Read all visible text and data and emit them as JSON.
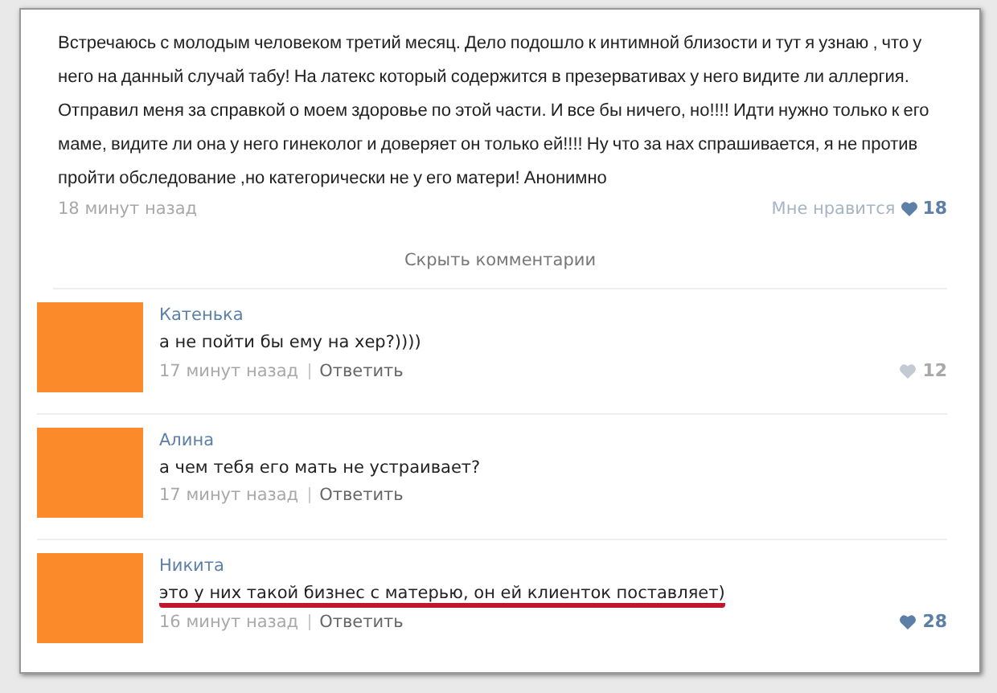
{
  "post": {
    "text": "Встречаюсь с молодым человеком третий месяц. Дело подошло к интимной близости и тут я узнаю , что у него на данный случай табу! На латекс который содержится в презервативах у него видите ли аллергия. Отправил меня за справкой о моем здоровье по этой части. И все бы ничего, но!!!! Идти нужно только к его маме, видите ли она у него гинеколог и доверяет он только ей!!!! Ну что за нах спрашивается, я не против пройти обследование ,но категорически не у его матери! Анонимно",
    "time": "18 минут назад",
    "like_label": "Мне нравится",
    "likes": "18",
    "liked": true
  },
  "hide_comments": "Скрыть комментарии",
  "comments": [
    {
      "author": "Катенька",
      "text": "а не пойти бы ему на хер?))))",
      "time": "17 минут назад",
      "reply": "Ответить",
      "likes": "12",
      "liked": false,
      "underlined": false
    },
    {
      "author": "Алина",
      "text": "а чем тебя его мать не устраивает?",
      "time": "17 минут назад",
      "reply": "Ответить",
      "underlined": false
    },
    {
      "author": "Никита",
      "text": "это у них такой бизнес с матерью, он ей клиенток поставляет)",
      "time": "16 минут назад",
      "reply": "Ответить",
      "likes": "28",
      "liked": true,
      "underlined": true
    }
  ]
}
